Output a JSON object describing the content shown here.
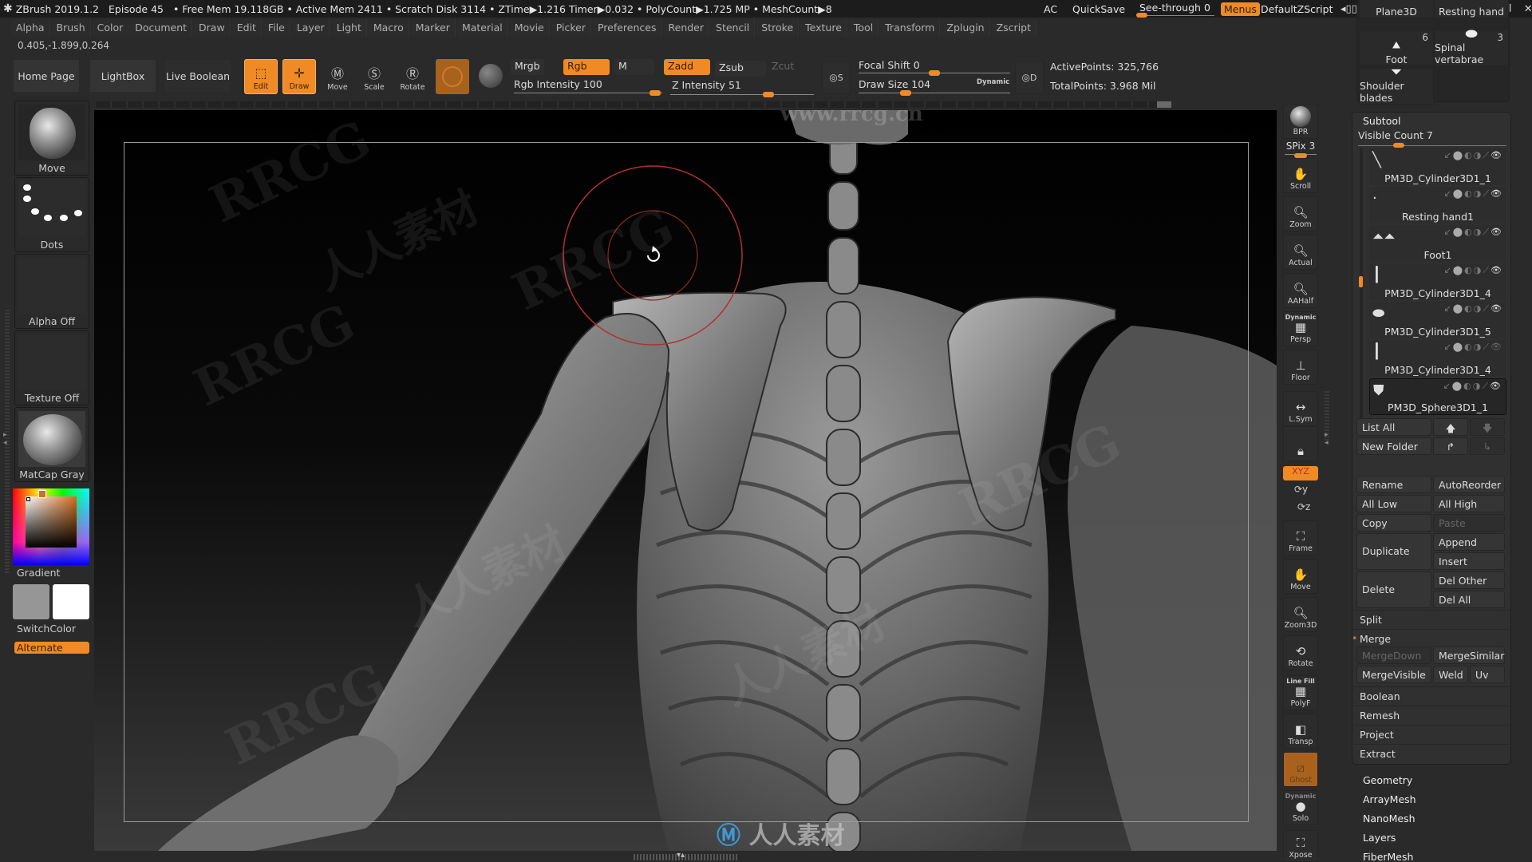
{
  "titlebar": {
    "app": "ZBrush 2019.1.2",
    "episode": "Episode 45",
    "stats": "• Free Mem 19.118GB • Active Mem 2411 • Scratch Disk 3114 •  ZTime▶1.216 Timer▶0.032 • PolyCount▶1.725 MP  • MeshCount▶8",
    "ac": "AC",
    "quicksave": "QuickSave",
    "see_through_label": "See-through",
    "see_through_value": "0",
    "see_through_fraction": 0.0,
    "menus": "Menus",
    "script": "DefaultZScript",
    "icons": [
      "tray-left-icon",
      "tray-right-icon",
      "swap-left-icon",
      "swap-right-icon",
      "lock-icon",
      "minimize-icon",
      "restore-icon",
      "close-icon"
    ]
  },
  "menubar": [
    "Alpha",
    "Brush",
    "Color",
    "Document",
    "Draw",
    "Edit",
    "File",
    "Layer",
    "Light",
    "Macro",
    "Marker",
    "Material",
    "Movie",
    "Picker",
    "Preferences",
    "Render",
    "Stencil",
    "Stroke",
    "Texture",
    "Tool",
    "Transform",
    "Zplugin",
    "Zscript"
  ],
  "coords": "0.405,-1.899,0.264",
  "shelf": {
    "home_page": "Home Page",
    "lightbox": "LightBox",
    "live_boolean": "Live Boolean",
    "edit": "Edit",
    "draw": "Draw",
    "move": "Move",
    "scale": "Scale",
    "rotate": "Rotate",
    "mrgb": "Mrgb",
    "rgb": "Rgb",
    "m": "M",
    "zadd": "Zadd",
    "zsub": "Zsub",
    "zcut": "Zcut",
    "rgb_intensity_label": "Rgb Intensity",
    "rgb_intensity": "100",
    "z_intensity_label": "Z Intensity",
    "z_intensity": "51",
    "focal_shift_label": "Focal Shift",
    "focal_shift": "0",
    "draw_size_label": "Draw Size",
    "draw_size": "104",
    "dynamic": "Dynamic",
    "lazy_s": "S",
    "lazy_d": "D",
    "active_points": "ActivePoints: 325,766",
    "total_points": "TotalPoints: 3.968 Mil"
  },
  "left_tray": {
    "brush": "Move",
    "stroke": "Dots",
    "alpha": "Alpha Off",
    "texture": "Texture Off",
    "material": "MatCap Gray",
    "gradient": "Gradient",
    "switch_color": "SwitchColor",
    "alternate": "Alternate",
    "main_color": "#969696",
    "secondary_color": "#ffffff",
    "picked_hue": "#d07020"
  },
  "right_shelf": [
    {
      "label": "BPR",
      "icon": "bpr-sphere-icon"
    },
    {
      "label": "SPix 3",
      "icon": "spix-slider-icon"
    },
    {
      "label": "Scroll",
      "icon": "hand-scroll-icon"
    },
    {
      "label": "Zoom",
      "icon": "zoom-icon"
    },
    {
      "label": "Actual",
      "icon": "actual-size-icon"
    },
    {
      "label": "AAHalf",
      "icon": "aahalf-icon"
    },
    {
      "label": "Persp",
      "icon": "perspective-icon",
      "top": "Dynamic"
    },
    {
      "label": "Floor",
      "icon": "floor-icon"
    },
    {
      "label": "L.Sym",
      "icon": "local-symmetry-icon"
    },
    {
      "label": "",
      "icon": "camera-lock-icon"
    },
    {
      "label": "XYZ",
      "icon": "rotate-xyz-icon"
    },
    {
      "label": "Frame",
      "icon": "frame-icon"
    },
    {
      "label": "Move",
      "icon": "move-3d-icon"
    },
    {
      "label": "Zoom3D",
      "icon": "zoom3d-icon"
    },
    {
      "label": "Rotate",
      "icon": "rotate-3d-icon"
    },
    {
      "label": "PolyF",
      "icon": "polyframe-icon",
      "top": "Line Fill"
    },
    {
      "label": "Transp",
      "icon": "transparency-icon"
    },
    {
      "label": "Ghost",
      "icon": "ghost-icon"
    },
    {
      "label": "Solo",
      "icon": "solo-icon",
      "top": "Dynamic"
    },
    {
      "label": "Xpose",
      "icon": "xpose-icon"
    }
  ],
  "tool_grid": [
    {
      "name": "Plane3D"
    },
    {
      "name": "Resting hand"
    },
    {
      "name": "Foot",
      "count": "6"
    },
    {
      "name": "Spinal vertabrae",
      "count": "3"
    },
    {
      "name": "Shoulder blades"
    }
  ],
  "subtool": {
    "title": "Subtool",
    "visible_count_label": "Visible Count",
    "visible_count": "7",
    "items": [
      {
        "name": "PM3D_Cylinder3D1_1",
        "visible": true
      },
      {
        "name": "Resting hand1",
        "visible": true
      },
      {
        "name": "Foot1",
        "visible": true
      },
      {
        "name": "PM3D_Cylinder3D1_4",
        "visible": true
      },
      {
        "name": "PM3D_Cylinder3D1_5",
        "visible": true
      },
      {
        "name": "PM3D_Cylinder3D1_4",
        "visible": false
      },
      {
        "name": "PM3D_Sphere3D1_1",
        "visible": true,
        "selected": true
      }
    ],
    "list_all": "List All",
    "new_folder": "New Folder",
    "rename": "Rename",
    "auto_reorder": "AutoReorder",
    "all_low": "All Low",
    "all_high": "All High",
    "copy": "Copy",
    "paste": "Paste",
    "duplicate": "Duplicate",
    "append": "Append",
    "insert": "Insert",
    "delete": "Delete",
    "del_other": "Del Other",
    "del_all": "Del All",
    "split": "Split",
    "merge": "Merge",
    "merge_down": "MergeDown",
    "merge_similar": "MergeSimilar",
    "merge_visible": "MergeVisible",
    "weld": "Weld",
    "uv": "Uv",
    "boolean": "Boolean",
    "remesh": "Remesh",
    "project": "Project",
    "extract": "Extract"
  },
  "tool_submenus": [
    "Geometry",
    "ArrayMesh",
    "NanoMesh",
    "Layers",
    "FiberMesh"
  ],
  "watermarks": {
    "site": "www.rrcg.cn",
    "brand": "RRCG",
    "cn": "人人素材"
  },
  "accent": "#f08a24"
}
